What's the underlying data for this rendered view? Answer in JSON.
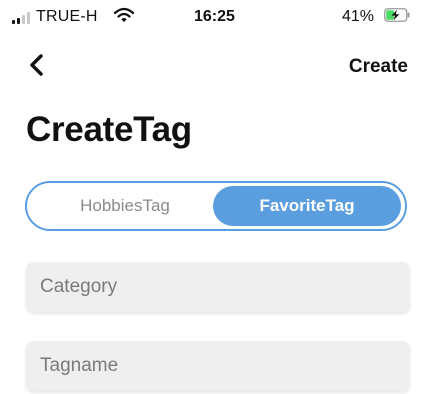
{
  "status_bar": {
    "carrier": "TRUE-H",
    "time": "16:25",
    "battery_percent": "41%",
    "battery_level": 0.41,
    "signal_bars_active": 2,
    "signal_bars_total": 4,
    "icons": [
      "signal-icon",
      "wifi-icon",
      "battery-charging-icon"
    ]
  },
  "nav": {
    "back_icon": "chevron-left-icon",
    "create_label": "Create"
  },
  "page": {
    "title": "CreateTag"
  },
  "segmented": {
    "options": [
      "HobbiesTag",
      "FavoriteTag"
    ],
    "selected": "FavoriteTag",
    "accent": "#5b9ee0"
  },
  "form": {
    "category": {
      "value": "",
      "placeholder": "Category"
    },
    "tagname": {
      "value": "",
      "placeholder": "Tagname"
    }
  }
}
